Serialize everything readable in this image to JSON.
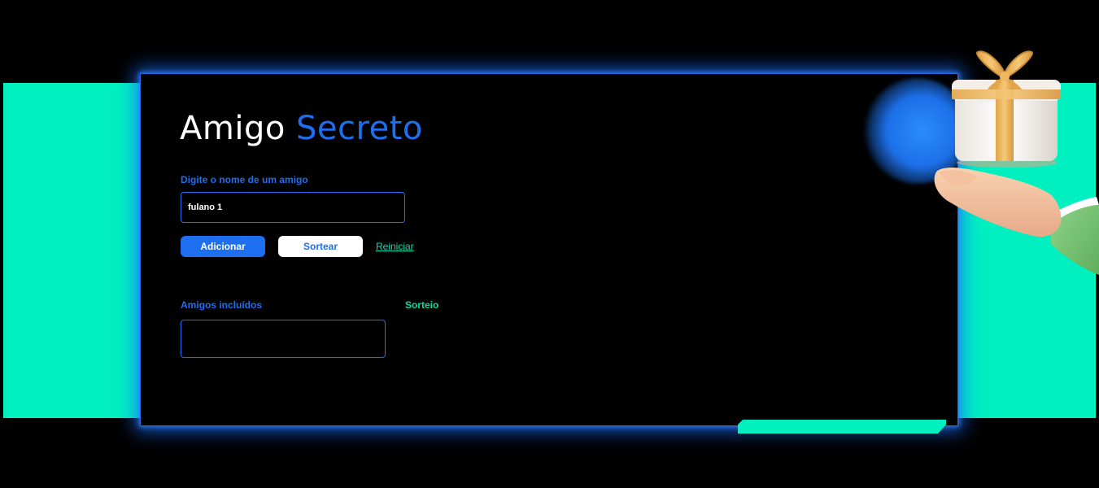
{
  "app": {
    "title_part1": "Amigo",
    "title_part2": "Secreto"
  },
  "form": {
    "label": "Digite o nome de um amigo",
    "input_value": "fulano 1",
    "add_button": "Adicionar",
    "draw_button": "Sortear",
    "reset_link": "Reiniciar"
  },
  "lists": {
    "friends_label": "Amigos incluídos",
    "result_label": "Sorteio",
    "friends": [],
    "result": []
  },
  "colors": {
    "accent_blue": "#1e6ff0",
    "accent_green": "#00f0c0",
    "background": "#000000",
    "text": "#ffffff"
  },
  "icons": {
    "hero": "gift-on-hand-illustration"
  }
}
